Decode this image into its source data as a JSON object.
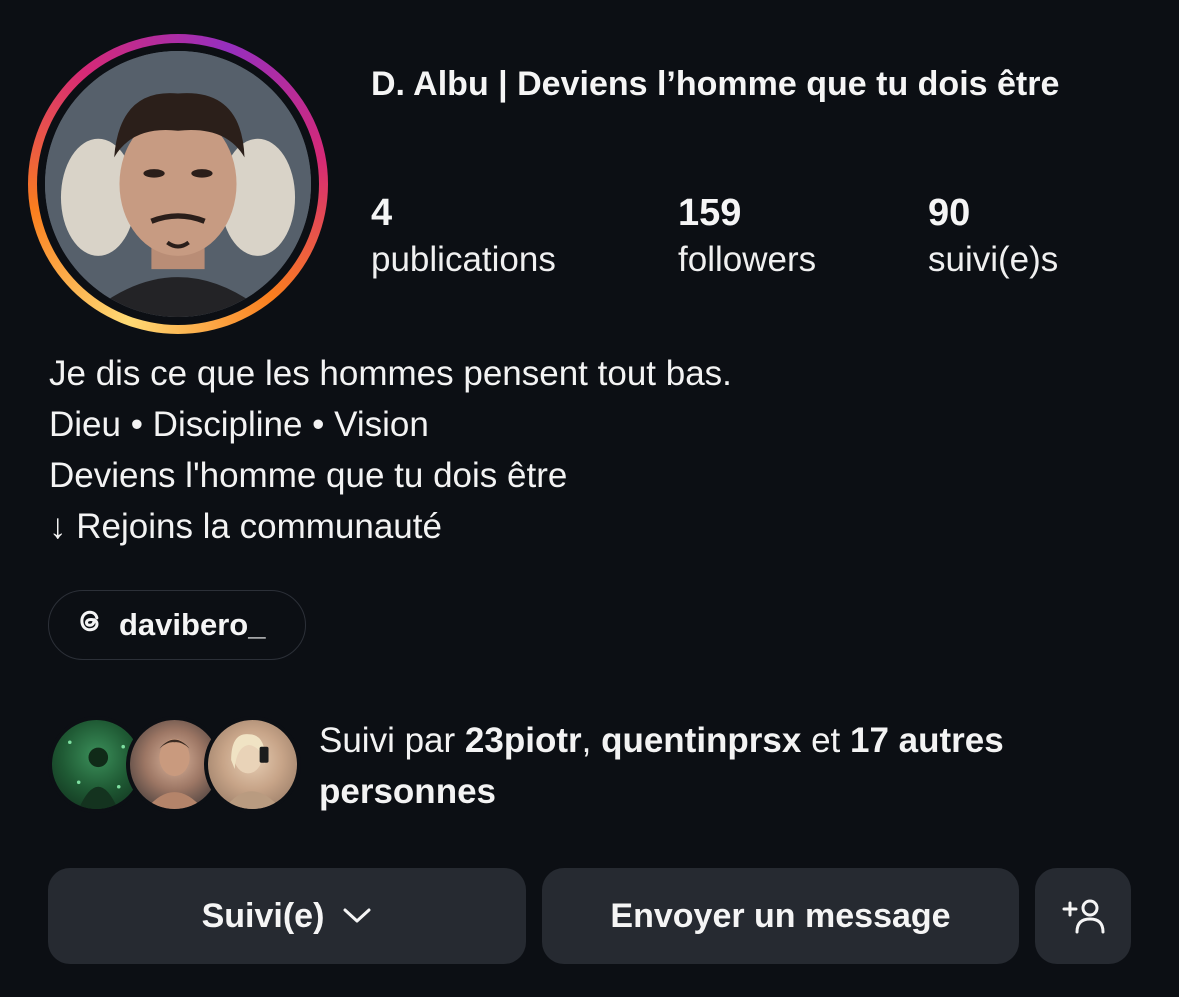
{
  "profile": {
    "name": "D. Albu | Deviens l’homme que tu dois être",
    "stats": [
      {
        "count": "4",
        "label": "publications"
      },
      {
        "count": "159",
        "label": "followers"
      },
      {
        "count": "90",
        "label": "suivi(e)s"
      }
    ],
    "bio": [
      "Je dis ce que les hommes pensent tout bas.",
      "Dieu • Discipline • Vision",
      "Deviens l'homme que tu dois être",
      "↓ Rejoins la communauté"
    ],
    "threads_handle": "davibero_"
  },
  "followed_by": {
    "prefix": "Suivi par ",
    "user1": "23piotr",
    "sep": ", ",
    "user2": "quentinprsx",
    "and": " et ",
    "others": "17 autres personnes"
  },
  "actions": {
    "follow_label": "Suivi(e)",
    "message_label": "Envoyer un message"
  },
  "icons": {
    "threads": "threads-icon",
    "chevron": "chevron-down-icon",
    "add_person": "add-person-icon"
  },
  "colors": {
    "background": "#0c0f14",
    "button": "#262a31",
    "ring": [
      "#feda75",
      "#fa7e1e",
      "#d62976",
      "#962fbf"
    ]
  }
}
